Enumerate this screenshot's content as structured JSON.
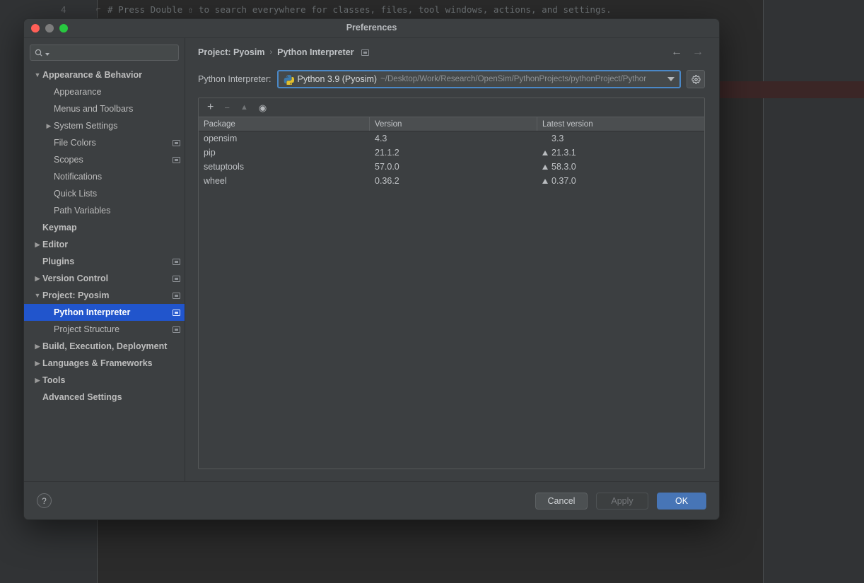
{
  "backdrop": {
    "line_number": "4",
    "code_comment": "# Press Double ⇧ to search everywhere for classes, files, tool windows, actions, and settings."
  },
  "dialog": {
    "title": "Preferences",
    "window_controls": [
      "close",
      "minimize",
      "zoom"
    ]
  },
  "search": {
    "value": "",
    "placeholder": ""
  },
  "sidebar": {
    "items": [
      {
        "label": "Appearance & Behavior",
        "arrow": "▼",
        "indent": 0,
        "bold": true,
        "badge": false,
        "selected": false
      },
      {
        "label": "Appearance",
        "arrow": "",
        "indent": 1,
        "bold": false,
        "badge": false,
        "selected": false
      },
      {
        "label": "Menus and Toolbars",
        "arrow": "",
        "indent": 1,
        "bold": false,
        "badge": false,
        "selected": false
      },
      {
        "label": "System Settings",
        "arrow": "▶",
        "indent": 1,
        "bold": false,
        "badge": false,
        "selected": false
      },
      {
        "label": "File Colors",
        "arrow": "",
        "indent": 1,
        "bold": false,
        "badge": true,
        "selected": false
      },
      {
        "label": "Scopes",
        "arrow": "",
        "indent": 1,
        "bold": false,
        "badge": true,
        "selected": false
      },
      {
        "label": "Notifications",
        "arrow": "",
        "indent": 1,
        "bold": false,
        "badge": false,
        "selected": false
      },
      {
        "label": "Quick Lists",
        "arrow": "",
        "indent": 1,
        "bold": false,
        "badge": false,
        "selected": false
      },
      {
        "label": "Path Variables",
        "arrow": "",
        "indent": 1,
        "bold": false,
        "badge": false,
        "selected": false
      },
      {
        "label": "Keymap",
        "arrow": "",
        "indent": 0,
        "bold": true,
        "badge": false,
        "selected": false
      },
      {
        "label": "Editor",
        "arrow": "▶",
        "indent": 0,
        "bold": true,
        "badge": false,
        "selected": false
      },
      {
        "label": "Plugins",
        "arrow": "",
        "indent": 0,
        "bold": true,
        "badge": true,
        "selected": false
      },
      {
        "label": "Version Control",
        "arrow": "▶",
        "indent": 0,
        "bold": true,
        "badge": true,
        "selected": false
      },
      {
        "label": "Project: Pyosim",
        "arrow": "▼",
        "indent": 0,
        "bold": true,
        "badge": true,
        "selected": false
      },
      {
        "label": "Python Interpreter",
        "arrow": "",
        "indent": 1,
        "bold": false,
        "badge": true,
        "selected": true
      },
      {
        "label": "Project Structure",
        "arrow": "",
        "indent": 1,
        "bold": false,
        "badge": true,
        "selected": false
      },
      {
        "label": "Build, Execution, Deployment",
        "arrow": "▶",
        "indent": 0,
        "bold": true,
        "badge": false,
        "selected": false
      },
      {
        "label": "Languages & Frameworks",
        "arrow": "▶",
        "indent": 0,
        "bold": true,
        "badge": false,
        "selected": false
      },
      {
        "label": "Tools",
        "arrow": "▶",
        "indent": 0,
        "bold": true,
        "badge": false,
        "selected": false
      },
      {
        "label": "Advanced Settings",
        "arrow": "",
        "indent": 0,
        "bold": true,
        "badge": false,
        "selected": false
      }
    ]
  },
  "breadcrumb": {
    "parent": "Project: Pyosim",
    "separator": "›",
    "current": "Python Interpreter"
  },
  "interpreter": {
    "label": "Python Interpreter:",
    "name": "Python 3.9 (Pyosim)",
    "path": "~/Desktop/Work/Research/OpenSim/PythonProjects/pythonProject/Pythor"
  },
  "packages": {
    "toolbar": [
      {
        "icon": "add-icon",
        "glyph": "+",
        "enabled": true
      },
      {
        "icon": "remove-icon",
        "glyph": "−",
        "enabled": false
      },
      {
        "icon": "upgrade-icon",
        "glyph": "▲",
        "enabled": false
      },
      {
        "icon": "show-early-releases-icon",
        "glyph": "◉",
        "enabled": true
      }
    ],
    "columns": [
      "Package",
      "Version",
      "Latest version"
    ],
    "rows": [
      {
        "package": "opensim",
        "version": "4.3",
        "latest": "3.3",
        "upgradable": false
      },
      {
        "package": "pip",
        "version": "21.1.2",
        "latest": "21.3.1",
        "upgradable": true
      },
      {
        "package": "setuptools",
        "version": "57.0.0",
        "latest": "58.3.0",
        "upgradable": true
      },
      {
        "package": "wheel",
        "version": "0.36.2",
        "latest": "0.37.0",
        "upgradable": true
      }
    ]
  },
  "footer": {
    "help": "?",
    "cancel": "Cancel",
    "apply": "Apply",
    "ok": "OK"
  },
  "colors": {
    "dialog_bg": "#3c3f41",
    "selection_blue": "#2155cc",
    "primary_button": "#4775b6",
    "combo_focus_border": "#4a88c7",
    "backdrop_bg": "#2b2b2b",
    "highlight_band": "#3b2626"
  }
}
